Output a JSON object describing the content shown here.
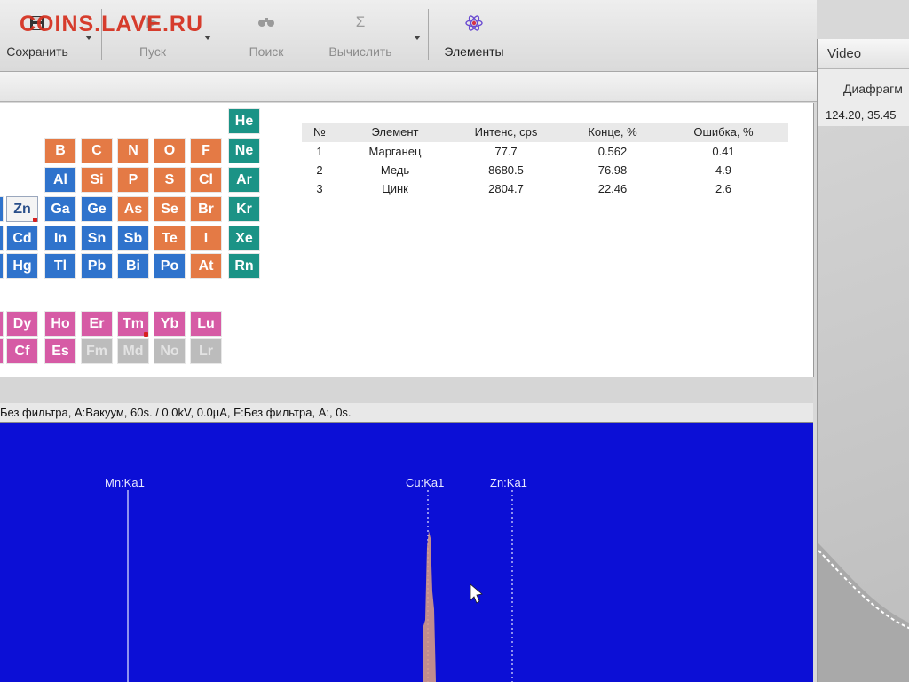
{
  "watermark": "COINS.LAVE.RU",
  "toolbar": {
    "save_label": "Сохранить",
    "start_label": "Пуск",
    "search_label": "Поиск",
    "calculate_label": "Вычислить",
    "calculate_icon": "Σ",
    "elements_label": "Элементы"
  },
  "periodic_table": {
    "elements": [
      {
        "symbol": "He",
        "group": "noble"
      },
      {
        "symbol": "B",
        "group": "nonmetal"
      },
      {
        "symbol": "C",
        "group": "nonmetal"
      },
      {
        "symbol": "N",
        "group": "nonmetal"
      },
      {
        "symbol": "O",
        "group": "nonmetal"
      },
      {
        "symbol": "F",
        "group": "nonmetal"
      },
      {
        "symbol": "Ne",
        "group": "noble"
      },
      {
        "symbol": "Al",
        "group": "metal"
      },
      {
        "symbol": "Si",
        "group": "nonmetal"
      },
      {
        "symbol": "P",
        "group": "nonmetal"
      },
      {
        "symbol": "S",
        "group": "nonmetal"
      },
      {
        "symbol": "Cl",
        "group": "nonmetal"
      },
      {
        "symbol": "Ar",
        "group": "noble"
      },
      {
        "symbol": "Zn",
        "group": "selected"
      },
      {
        "symbol": "Ga",
        "group": "metal"
      },
      {
        "symbol": "Ge",
        "group": "metal"
      },
      {
        "symbol": "As",
        "group": "nonmetal"
      },
      {
        "symbol": "Se",
        "group": "nonmetal"
      },
      {
        "symbol": "Br",
        "group": "nonmetal"
      },
      {
        "symbol": "Kr",
        "group": "noble"
      },
      {
        "symbol": "Cd",
        "group": "metal"
      },
      {
        "symbol": "In",
        "group": "metal"
      },
      {
        "symbol": "Sn",
        "group": "metal"
      },
      {
        "symbol": "Sb",
        "group": "metal"
      },
      {
        "symbol": "Te",
        "group": "nonmetal"
      },
      {
        "symbol": "I",
        "group": "nonmetal"
      },
      {
        "symbol": "Xe",
        "group": "noble"
      },
      {
        "symbol": "Hg",
        "group": "metal"
      },
      {
        "symbol": "Tl",
        "group": "metal"
      },
      {
        "symbol": "Pb",
        "group": "metal"
      },
      {
        "symbol": "Bi",
        "group": "metal"
      },
      {
        "symbol": "Po",
        "group": "metal"
      },
      {
        "symbol": "At",
        "group": "nonmetal"
      },
      {
        "symbol": "Rn",
        "group": "noble"
      },
      {
        "symbol": "Dy",
        "group": "rare_earth"
      },
      {
        "symbol": "Ho",
        "group": "rare_earth"
      },
      {
        "symbol": "Er",
        "group": "rare_earth"
      },
      {
        "symbol": "Tm",
        "group": "rare_earth"
      },
      {
        "symbol": "Yb",
        "group": "rare_earth"
      },
      {
        "symbol": "Lu",
        "group": "rare_earth"
      },
      {
        "symbol": "Cf",
        "group": "rare_earth"
      },
      {
        "symbol": "Es",
        "group": "rare_earth"
      },
      {
        "symbol": "Fm",
        "group": "unavailable"
      },
      {
        "symbol": "Md",
        "group": "unavailable"
      },
      {
        "symbol": "No",
        "group": "unavailable"
      },
      {
        "symbol": "Lr",
        "group": "unavailable"
      }
    ],
    "marked": [
      "Zn",
      "Tm"
    ],
    "colors": {
      "noble": "#1b9386",
      "nonmetal": "#e47a45",
      "metal": "#2f73cc",
      "rare_earth": "#d65ba5",
      "unavailable": "#bcbcbc",
      "selected": "#f4f4f4"
    }
  },
  "results": {
    "headers": [
      "№",
      "Элемент",
      "Интенс, cps",
      "Конце, %",
      "Ошибка, %"
    ],
    "rows": [
      [
        "1",
        "Марганец",
        "77.7",
        "0.562",
        "0.41"
      ],
      [
        "2",
        "Медь",
        "8680.5",
        "76.98",
        "4.9"
      ],
      [
        "3",
        "Цинк",
        "2804.7",
        "22.46",
        "2.6"
      ]
    ]
  },
  "status_text": "Без фильтра, А:Вакуум, 60s. /   0.0kV, 0.0µA, F:Без фильтра, A:, 0s.",
  "spectrum": {
    "background": "#0c0fd6",
    "peak_color": "#d49a86",
    "markers": [
      "Mn:Ka1",
      "Cu:Ka1",
      "Zn:Ka1"
    ]
  },
  "video": {
    "title": "Video",
    "option_label": "Диафрагм",
    "coords": "124.20, 35.45"
  }
}
